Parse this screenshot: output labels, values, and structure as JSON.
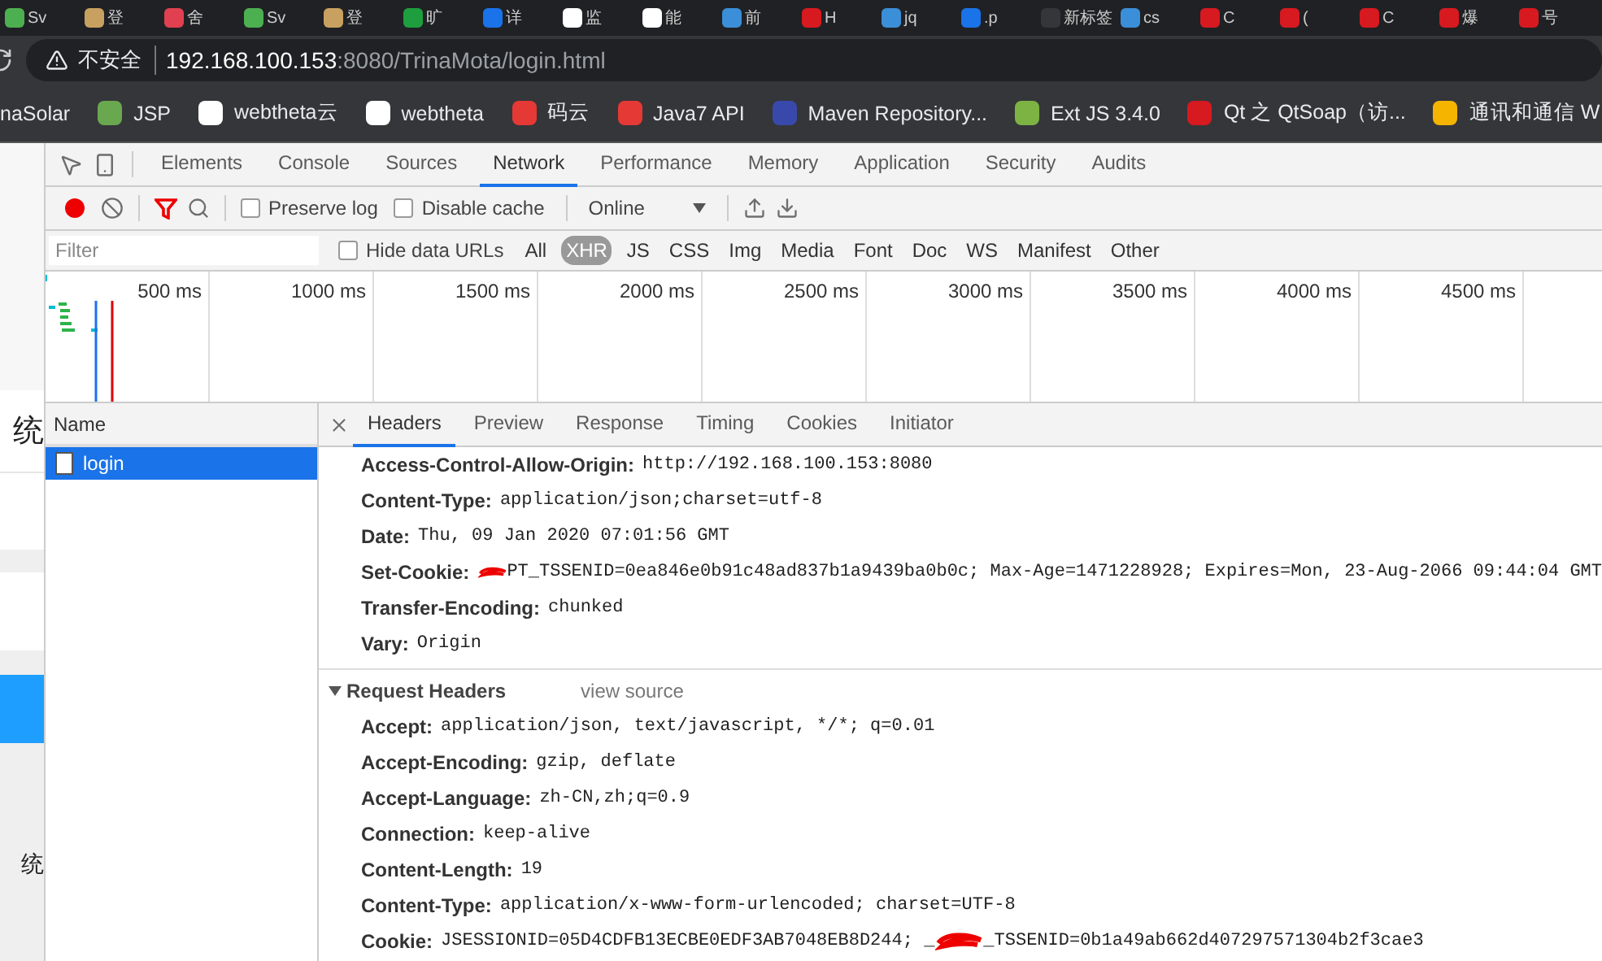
{
  "browser_tabs": [
    {
      "label": "Sv",
      "color": "#4caf50"
    },
    {
      "label": "登",
      "color": "#c8a060"
    },
    {
      "label": "舍",
      "color": "#e04050"
    },
    {
      "label": "Sv",
      "color": "#4caf50"
    },
    {
      "label": "登",
      "color": "#c8a060"
    },
    {
      "label": "旷",
      "color": "#1e9e3e"
    },
    {
      "label": "详",
      "color": "#1a73e8"
    },
    {
      "label": "监",
      "color": "#ffffff"
    },
    {
      "label": "能",
      "color": "#ffffff"
    },
    {
      "label": "前",
      "color": "#3b8ed8"
    },
    {
      "label": "H",
      "color": "#d71920"
    },
    {
      "label": "jq",
      "color": "#3b8ed8"
    },
    {
      "label": ".p",
      "color": "#1a73e8"
    },
    {
      "label": "新标签",
      "color": "#35363a"
    },
    {
      "label": "cs",
      "color": "#3b8ed8"
    },
    {
      "label": "C",
      "color": "#d71920"
    },
    {
      "label": "(",
      "color": "#d71920"
    },
    {
      "label": "C",
      "color": "#d71920"
    },
    {
      "label": "爆",
      "color": "#d71920"
    },
    {
      "label": "号",
      "color": "#d71920"
    }
  ],
  "address_bar": {
    "security_label": "不安全",
    "host": "192.168.100.153",
    "path": ":8080/TrinaMota/login.html"
  },
  "bookmarks": [
    {
      "label": "naSolar"
    },
    {
      "label": "JSP",
      "color": "#6aa84f"
    },
    {
      "label": "webtheta云",
      "color": "#ffffff"
    },
    {
      "label": "webtheta",
      "color": "#ffffff"
    },
    {
      "label": "码云",
      "color": "#e53935"
    },
    {
      "label": "Java7 API",
      "color": "#e53935"
    },
    {
      "label": "Maven Repository...",
      "color": "#3949ab"
    },
    {
      "label": "Ext JS 3.4.0",
      "color": "#7cb342"
    },
    {
      "label": "Qt 之 QtSoap（访...",
      "color": "#d71920"
    },
    {
      "label": "通讯和通信 W",
      "color": "#f4b400"
    }
  ],
  "page_behind": {
    "texts": [
      "统",
      "统"
    ]
  },
  "devtools": {
    "panels": [
      {
        "label": "Elements",
        "selected": false
      },
      {
        "label": "Console",
        "selected": false
      },
      {
        "label": "Sources",
        "selected": false
      },
      {
        "label": "Network",
        "selected": true
      },
      {
        "label": "Performance",
        "selected": false
      },
      {
        "label": "Memory",
        "selected": false
      },
      {
        "label": "Application",
        "selected": false
      },
      {
        "label": "Security",
        "selected": false
      },
      {
        "label": "Audits",
        "selected": false
      }
    ],
    "toolbar": {
      "recording": true,
      "filter_active": true,
      "preserve_log": {
        "label": "Preserve log",
        "checked": false
      },
      "disable_cache": {
        "label": "Disable cache",
        "checked": false
      },
      "throttling": "Online"
    },
    "filter_bar": {
      "placeholder": "Filter",
      "hide_data_urls": {
        "label": "Hide data URLs",
        "checked": false
      },
      "types": [
        {
          "label": "All",
          "selected": false
        },
        {
          "label": "XHR",
          "selected": true
        },
        {
          "label": "JS",
          "selected": false
        },
        {
          "label": "CSS",
          "selected": false
        },
        {
          "label": "Img",
          "selected": false
        },
        {
          "label": "Media",
          "selected": false
        },
        {
          "label": "Font",
          "selected": false
        },
        {
          "label": "Doc",
          "selected": false
        },
        {
          "label": "WS",
          "selected": false
        },
        {
          "label": "Manifest",
          "selected": false
        },
        {
          "label": "Other",
          "selected": false
        }
      ]
    },
    "timeline": {
      "ticks": [
        "500 ms",
        "1000 ms",
        "1500 ms",
        "2000 ms",
        "2500 ms",
        "3000 ms",
        "3500 ms",
        "4000 ms",
        "4500 ms"
      ]
    },
    "requests": {
      "column": "Name",
      "rows": [
        {
          "name": "login",
          "selected": true
        }
      ]
    },
    "detail": {
      "tabs": [
        {
          "label": "Headers",
          "selected": true
        },
        {
          "label": "Preview",
          "selected": false
        },
        {
          "label": "Response",
          "selected": false
        },
        {
          "label": "Timing",
          "selected": false
        },
        {
          "label": "Cookies",
          "selected": false
        },
        {
          "label": "Initiator",
          "selected": false
        }
      ],
      "response_headers": [
        {
          "kind": "plain",
          "name": "Access-Control-Allow-Origin:",
          "value": "http://192.168.100.153:8080"
        },
        {
          "kind": "plain",
          "name": "Content-Type:",
          "value": "application/json;charset=utf-8"
        },
        {
          "kind": "plain",
          "name": "Date:",
          "value": "Thu, 09 Jan 2020 07:01:56 GMT"
        },
        {
          "kind": "redacted",
          "name": "Set-Cookie:",
          "value_after": "PT_TSSENID=0ea846e0b91c48ad837b1a9439ba0b0c; Max-Age=1471228928; Expires=Mon, 23-Aug-2066 09:44:04 GMT"
        },
        {
          "kind": "plain",
          "name": "Transfer-Encoding:",
          "value": "chunked"
        },
        {
          "kind": "plain",
          "name": "Vary:",
          "value": "Origin"
        }
      ],
      "request_headers": {
        "title": "Request Headers",
        "expanded": true,
        "view_source": "view source",
        "rows": [
          {
            "kind": "plain",
            "name": "Accept:",
            "value": "application/json, text/javascript, */*; q=0.01"
          },
          {
            "kind": "plain",
            "name": "Accept-Encoding:",
            "value": "gzip, deflate"
          },
          {
            "kind": "plain",
            "name": "Accept-Language:",
            "value": "zh-CN,zh;q=0.9"
          },
          {
            "kind": "plain",
            "name": "Connection:",
            "value": "keep-alive"
          },
          {
            "kind": "plain",
            "name": "Content-Length:",
            "value": "19"
          },
          {
            "kind": "plain",
            "name": "Content-Type:",
            "value": "application/x-www-form-urlencoded; charset=UTF-8"
          },
          {
            "kind": "redacted",
            "name": "Cookie:",
            "value_before": "JSESSIONID=05D4CDFB13ECBE0EDF3AB7048EB8D244; _",
            "value_after": "_TSSENID=0b1a49ab662d407297571304b2f3cae3"
          }
        ]
      }
    }
  }
}
